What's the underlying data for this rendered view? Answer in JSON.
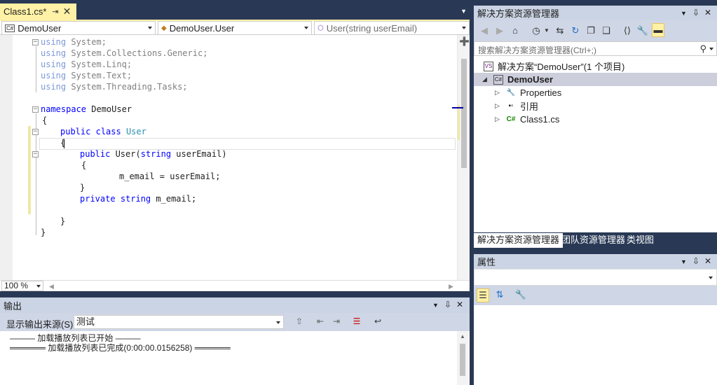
{
  "editor": {
    "tab": {
      "title": "Class1.cs*",
      "pin": "→",
      "close": "✕"
    },
    "nav": {
      "project": "DemoUser",
      "class": "DemoUser.User",
      "member": "User(string userEmail)"
    },
    "zoom": "100 %",
    "code": {
      "l1_kw": "using",
      "l1_rest": " System;",
      "l2_kw": "using",
      "l2_rest": " System.Collections.Generic;",
      "l3_kw": "using",
      "l3_rest": " System.Linq;",
      "l4_kw": "using",
      "l4_rest": " System.Text;",
      "l5_kw": "using",
      "l5_rest": " System.Threading.Tasks;",
      "ns_kw": "namespace",
      "ns_name": " DemoUser",
      "open1": "{",
      "cls_kw1": "public",
      "cls_kw2": "class",
      "cls_name": "User",
      "open2": "{",
      "ctor_kw": "public",
      "ctor_rest1": " User(",
      "ctor_type": "string",
      "ctor_rest2": " userEmail)",
      "open3": "{",
      "assign": "m_email = userEmail;",
      "close3": "}",
      "field_kw1": "private",
      "field_kw2": "string",
      "field_rest": " m_email;",
      "close2": "}",
      "close1": "}"
    }
  },
  "output": {
    "title": "输出",
    "source_label": "显示输出来源(S):",
    "source_value": "测试",
    "line1": "——— 加载播放列表已开始 ———",
    "line2": "══════ 加载播放列表已完成(0:00:00.0156258) ══════"
  },
  "solution_explorer": {
    "title": "解决方案资源管理器",
    "search_placeholder": "搜索解决方案资源管理器(Ctrl+;)",
    "tree": {
      "solution": "解决方案“DemoUser”(1 个项目)",
      "project": "DemoUser",
      "properties": "Properties",
      "references": "引用",
      "file": "Class1.cs"
    },
    "tabs": [
      "解决方案资源管理器",
      "团队资源管理器",
      "类视图"
    ]
  },
  "properties": {
    "title": "属性"
  },
  "colors": {
    "chrome": "#293955",
    "active_tab": "#fff1a6",
    "panel_header": "#cbd4e4",
    "keyword": "#0000ff",
    "type": "#2b91af"
  }
}
